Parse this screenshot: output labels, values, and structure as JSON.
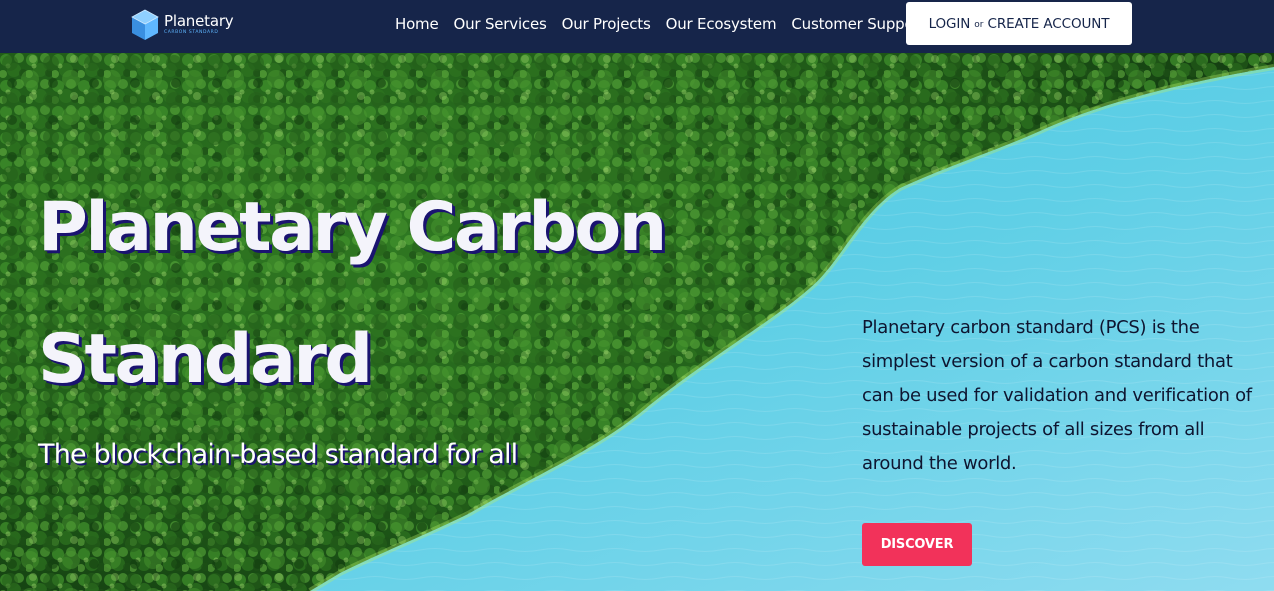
{
  "brand": {
    "name": "Planetary",
    "tagline": "CARBON STANDARD",
    "logo_icon": "cube-icon",
    "colors": {
      "navbar": "#16254a",
      "accent": "#f2325a",
      "logo_blue": "#5fb7ff"
    }
  },
  "nav": {
    "links": [
      {
        "label": "Home"
      },
      {
        "label": "Our Services"
      },
      {
        "label": "Our Projects"
      },
      {
        "label": "Our Ecosystem"
      },
      {
        "label": "Customer Support"
      }
    ],
    "login": {
      "primary": "LOGIN",
      "or": "or",
      "secondary": "CREATE ACCOUNT"
    }
  },
  "hero": {
    "title_line1": "Planetary Carbon",
    "title_line2": "Standard",
    "subtitle": "The blockchain-based standard for all",
    "description": "Planetary carbon standard (PCS) is the simplest version of a carbon standard that can be used for validation and verification of sustainable projects of all sizes from all around the world.",
    "cta": "DISCOVER",
    "background": "aerial-forest-and-lake-image"
  }
}
